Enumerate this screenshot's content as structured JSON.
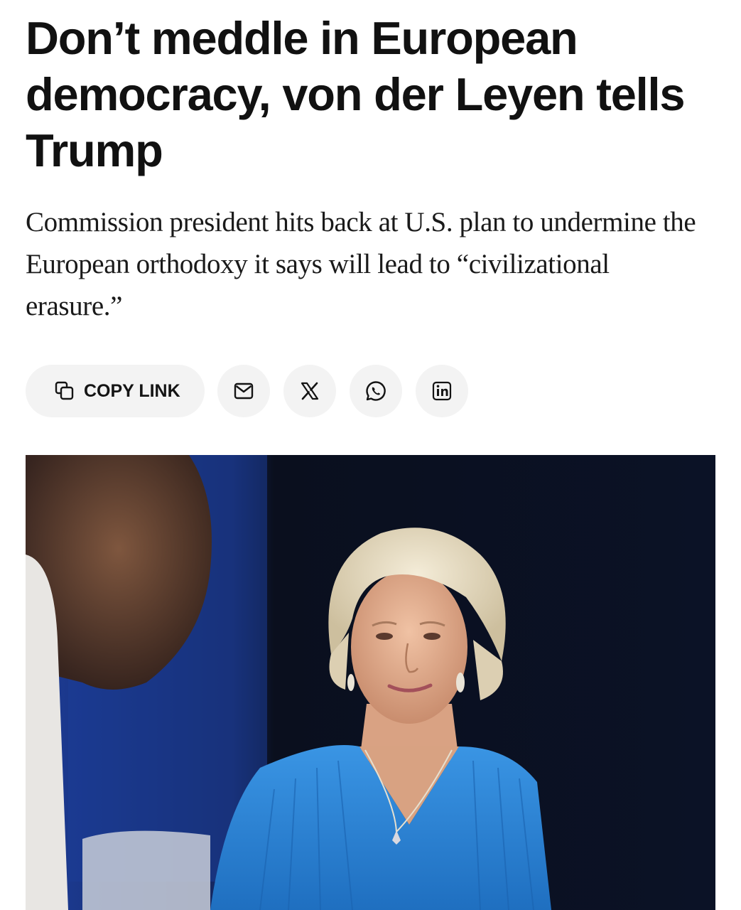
{
  "article": {
    "headline": "Don’t meddle in European democracy, von der Leyen tells Trump",
    "dek": "Commission president hits back at U.S. plan to undermine the European orthodoxy it says will lead to “civilizational erasure.”"
  },
  "share_bar": {
    "copy_link_label": "COPY LINK",
    "buttons": [
      {
        "icon": "mail-icon",
        "label": "Email"
      },
      {
        "icon": "x-icon",
        "label": "X"
      },
      {
        "icon": "whatsapp-icon",
        "label": "WhatsApp"
      },
      {
        "icon": "linkedin-icon",
        "label": "LinkedIn"
      }
    ],
    "button_bg": "#f3f3f3",
    "icon_color": "#141414"
  },
  "lead_image": {
    "alt": "Ursula von der Leyen on stage in a blue dress",
    "colors": {
      "background": "#0b1226",
      "stage_blue": "#1f3f96",
      "dress": "#2a86d8",
      "hair": "#e8dcc0"
    }
  }
}
